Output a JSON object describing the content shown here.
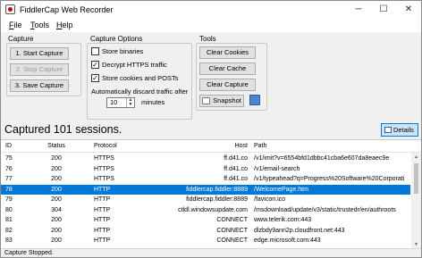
{
  "window": {
    "title": "FiddlerCap Web Recorder"
  },
  "controls": {
    "minimize": "─",
    "maximize": "☐",
    "close": "✕"
  },
  "menu": [
    {
      "label": "File",
      "key": "F",
      "rest": "ile"
    },
    {
      "label": "Tools",
      "key": "T",
      "rest": "ools"
    },
    {
      "label": "Help",
      "key": "H",
      "rest": "elp"
    }
  ],
  "capture": {
    "title": "Capture",
    "start_label": "1. Start Capture",
    "stop_label": "2. Stop Capture",
    "save_label": "3. Save Capture"
  },
  "options": {
    "title": "Capture Options",
    "store_binaries": {
      "label": "Store binaries",
      "checked": false
    },
    "decrypt_https": {
      "label": "Decrypt HTTPS traffic",
      "checked": true
    },
    "store_cookies": {
      "label": "Store cookies and POSTs",
      "checked": true
    },
    "auto_discard_label": "Automatically discard traffic after",
    "minutes_value": "10",
    "minutes_label": "minutes"
  },
  "tools": {
    "title": "Tools",
    "clear_cookies": "Clear Cookies",
    "clear_cache": "Clear Cache",
    "clear_capture": "Clear Capture",
    "snapshot": "Snapshot"
  },
  "summary": "Captured 101 sessions.",
  "details_label": "Details",
  "sessions": {
    "columns": {
      "id": "ID",
      "status": "Status",
      "protocol": "Protocol",
      "host": "Host",
      "path": "Path"
    },
    "rows": [
      {
        "id": "75",
        "status": "200",
        "protocol": "HTTPS",
        "host": "ff.d41.co",
        "path": "/v1/imit?v=6554bfd1dbbc41cba6e607da8eaec9e"
      },
      {
        "id": "76",
        "status": "200",
        "protocol": "HTTPS",
        "host": "ff.d41.co",
        "path": "/v1/email-search"
      },
      {
        "id": "77",
        "status": "200",
        "protocol": "HTTPS",
        "host": "ff.d41.co",
        "path": "/v1/typeahead?q=Progress%20Software%20Corporati"
      },
      {
        "id": "78",
        "status": "200",
        "protocol": "HTTP",
        "host": "fiddlercap.fiddler:8889",
        "path": "/WelcomePage.htm",
        "selected": true
      },
      {
        "id": "79",
        "status": "200",
        "protocol": "HTTP",
        "host": "fiddlercap.fiddler:8889",
        "path": "/favicon.ico"
      },
      {
        "id": "80",
        "status": "304",
        "protocol": "HTTP",
        "host": "ctldl.windowsupdate.com",
        "path": "/msdownload/update/v3/static/trustedr/en/authroots"
      },
      {
        "id": "81",
        "status": "200",
        "protocol": "HTTP",
        "host": "CONNECT",
        "path": "www.telerik.com:443"
      },
      {
        "id": "82",
        "status": "200",
        "protocol": "HTTP",
        "host": "CONNECT",
        "path": "dlzbdy9anri2p.cloudfront.net:443"
      },
      {
        "id": "83",
        "status": "200",
        "protocol": "HTTP",
        "host": "CONNECT",
        "path": "edge.microsoft.com:443"
      }
    ]
  },
  "status_bar": "Capture Stopped."
}
